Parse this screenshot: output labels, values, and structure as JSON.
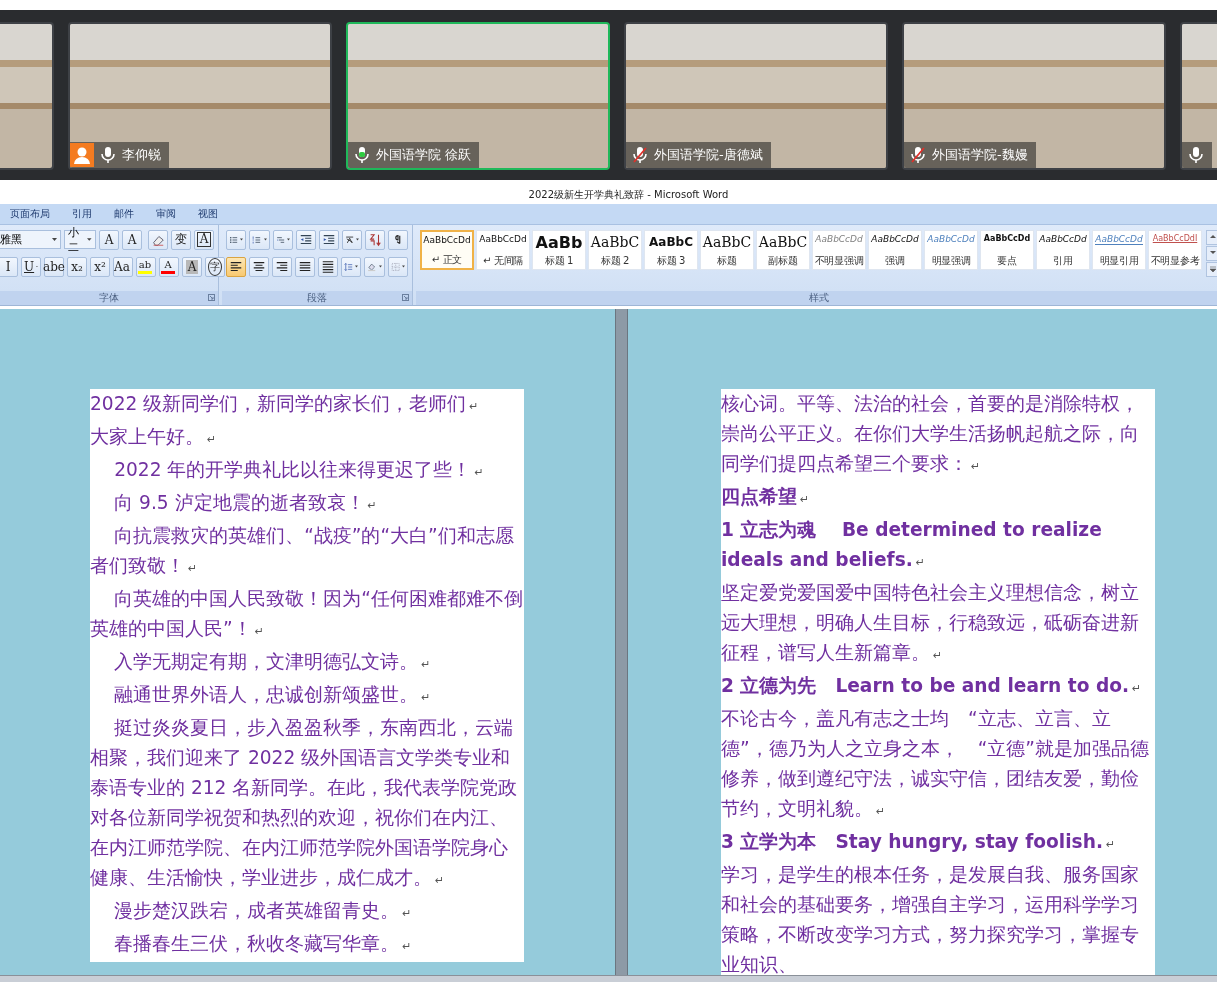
{
  "video_bar": {
    "tiles": [
      {
        "name": "李仰锐",
        "muted": false,
        "speaking": false,
        "avatar": true,
        "selected": false
      },
      {
        "name": "外国语学院 徐跃",
        "muted": false,
        "speaking": true,
        "avatar": false,
        "selected": true
      },
      {
        "name": "外国语学院-唐德斌",
        "muted": true,
        "speaking": false,
        "avatar": false,
        "selected": false
      },
      {
        "name": "外国语学院-魏嫚",
        "muted": true,
        "speaking": false,
        "avatar": false,
        "selected": false
      },
      {
        "muted": false,
        "speaking": false,
        "avatar": false,
        "selected": false
      }
    ]
  },
  "window": {
    "title": "2022级新生开学典礼致辞 - Microsoft Word"
  },
  "menu_tabs": [
    {
      "label": "页面布局"
    },
    {
      "label": "引用"
    },
    {
      "label": "邮件"
    },
    {
      "label": "审阅"
    },
    {
      "label": "视图"
    }
  ],
  "font_group": {
    "label": "字体",
    "font_name": "雅黑",
    "font_size": "小二",
    "row1": [
      {
        "kind": "text",
        "label": "A"
      },
      {
        "kind": "text",
        "label": "A"
      },
      {
        "kind": "icon"
      },
      {
        "kind": "text",
        "label": "变"
      },
      {
        "kind": "boxed",
        "label": "A"
      }
    ],
    "row2": [
      {
        "kind": "text",
        "label": "I"
      },
      {
        "kind": "caret",
        "label": "U"
      },
      {
        "kind": "text",
        "label": "abe"
      },
      {
        "kind": "text",
        "label": "x₂"
      },
      {
        "kind": "text",
        "label": "x²"
      },
      {
        "kind": "caret",
        "label": "Aa"
      },
      {
        "kind": "colorbar",
        "label": "ab",
        "color": "#ffff00"
      },
      {
        "kind": "colorbar",
        "label": "A",
        "color": "#ff0000"
      },
      {
        "kind": "shaded",
        "label": "A"
      },
      {
        "kind": "circled",
        "label": "字"
      }
    ]
  },
  "paragraph_group": {
    "label": "段落",
    "alignment": [
      {
        "selected": true
      },
      {
        "selected": false
      },
      {
        "selected": false
      },
      {
        "selected": false
      },
      {
        "selected": false
      }
    ]
  },
  "styles_group": {
    "label": "样式",
    "styles": [
      {
        "preview": "AaBbCcDd",
        "label": "↵ 正文",
        "kind": "normal",
        "selected": true
      },
      {
        "preview": "AaBbCcDd",
        "label": "↵ 无间隔",
        "kind": "normal",
        "selected": false
      },
      {
        "preview": "AaBb",
        "label": "标题 1",
        "kind": "h1",
        "selected": false
      },
      {
        "preview": "AaBbC",
        "label": "标题 2",
        "kind": "h2",
        "selected": false
      },
      {
        "preview": "AaBbC",
        "label": "标题 3",
        "kind": "h3",
        "selected": false
      },
      {
        "preview": "AaBbC",
        "label": "标题",
        "kind": "title",
        "selected": false
      },
      {
        "preview": "AaBbC",
        "label": "副标题",
        "kind": "title",
        "selected": false
      },
      {
        "preview": "AaBbCcDd",
        "label": "不明显强调",
        "kind": "subtle",
        "selected": false
      },
      {
        "preview": "AaBbCcDd",
        "label": "强调",
        "kind": "emphasis",
        "selected": false
      },
      {
        "preview": "AaBbCcDd",
        "label": "明显强调",
        "kind": "intense",
        "selected": false
      },
      {
        "preview": "AaBbCcDd",
        "label": "要点",
        "kind": "strong",
        "selected": false
      },
      {
        "preview": "AaBbCcDd",
        "label": "引用",
        "kind": "emphasis",
        "selected": false
      },
      {
        "preview": "AaBbCcDd",
        "label": "明显引用",
        "kind": "intense-quote",
        "selected": false
      },
      {
        "preview": "AaBbCcDdI",
        "label": "不明显参考",
        "kind": "subtle-ref",
        "selected": false
      }
    ]
  },
  "pages": [
    {
      "paragraphs": [
        {
          "text": "2022 级新同学们，新同学的家长们，老师们",
          "indent": false,
          "bold": false,
          "mark": "↵"
        },
        {
          "text": "大家上午好。",
          "indent": false,
          "bold": false,
          "mark": "↵"
        },
        {
          "text": "2022 年的开学典礼比以往来得更迟了些！",
          "indent": true,
          "bold": false,
          "mark": "↵"
        },
        {
          "text": "向 9.5 泸定地震的逝者致哀！",
          "indent": true,
          "bold": false,
          "mark": "↵"
        },
        {
          "text": "向抗震救灾的英雄们、“战疫”的“大白”们和志愿者们致敬！",
          "indent": true,
          "bold": false,
          "mark": "↵"
        },
        {
          "text": "向英雄的中国人民致敬！因为“任何困难都难不倒英雄的中国人民”！",
          "indent": true,
          "bold": false,
          "mark": "↵"
        },
        {
          "text": "入学无期定有期，文津明德弘文诗。",
          "indent": true,
          "bold": false,
          "mark": "↵"
        },
        {
          "text": "融通世界外语人，忠诚创新颂盛世。",
          "indent": true,
          "bold": false,
          "mark": "↵"
        },
        {
          "text": "挺过炎炎夏日，步入盈盈秋季，东南西北，云端相聚，我们迎来了 2022 级外国语言文学类专业和泰语专业的 212 名新同学。在此，我代表学院党政对各位新同学祝贺和热烈的欢迎，祝你们在内江、在内江师范学院、在内江师范学院外国语学院身心健康、生活愉快，学业进步，成仁成才。",
          "indent": true,
          "bold": false,
          "mark": "↵"
        },
        {
          "text": "漫步楚汉跌宕，成者英雄留青史。",
          "indent": true,
          "bold": false,
          "mark": "↵"
        },
        {
          "text": "春播春生三伏，秋收冬藏写华章。",
          "indent": true,
          "bold": false,
          "mark": "↵"
        }
      ]
    },
    {
      "paragraphs": [
        {
          "text": "核心词。平等、法治的社会，首要的是消除特权，崇尚公平正义。在你们大学生活扬帆起航之际，向同学们提四点希望三个要求：",
          "indent": false,
          "bold": false,
          "mark": "↵"
        },
        {
          "text": "四点希望",
          "indent": false,
          "bold": true,
          "mark": "↵"
        },
        {
          "text": "1 立志为魂　 Be determined to realize ideals and beliefs.",
          "indent": false,
          "bold": true,
          "mark": "↵"
        },
        {
          "text": "坚定爱党爱国爱中国特色社会主义理想信念，树立远大理想，明确人生目标，行稳致远，砥砺奋进新征程，谱写人生新篇章。",
          "indent": false,
          "bold": false,
          "mark": "↵"
        },
        {
          "text": "2 立德为先　Learn to be and learn to do.",
          "indent": false,
          "bold": true,
          "mark": "↵"
        },
        {
          "text": "不论古今，盖凡有志之士均　“立志、立言、立德”，德乃为人之立身之本，　“立德”就是加强品德修养，做到遵纪守法，诚实守信，团结友爱，勤俭节约，文明礼貌。",
          "indent": false,
          "bold": false,
          "mark": "↵"
        },
        {
          "text": "3 立学为本　Stay hungry, stay foolish.",
          "indent": false,
          "bold": true,
          "mark": "↵"
        },
        {
          "text": "学习，是学生的根本任务，是发展自我、服务国家和社会的基础要务，增强自主学习，运用科学学习策略，不断改变学习方式，努力探究学习，掌握专业知识、",
          "indent": false,
          "bold": false
        }
      ]
    }
  ]
}
